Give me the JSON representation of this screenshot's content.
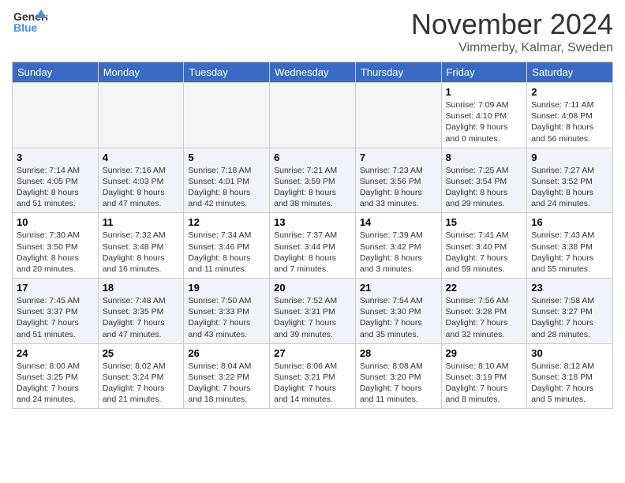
{
  "header": {
    "logo_line1": "General",
    "logo_line2": "Blue",
    "month_title": "November 2024",
    "location": "Vimmerby, Kalmar, Sweden"
  },
  "weekdays": [
    "Sunday",
    "Monday",
    "Tuesday",
    "Wednesday",
    "Thursday",
    "Friday",
    "Saturday"
  ],
  "weeks": [
    [
      {
        "day": "",
        "info": "",
        "empty": true
      },
      {
        "day": "",
        "info": "",
        "empty": true
      },
      {
        "day": "",
        "info": "",
        "empty": true
      },
      {
        "day": "",
        "info": "",
        "empty": true
      },
      {
        "day": "",
        "info": "",
        "empty": true
      },
      {
        "day": "1",
        "info": "Sunrise: 7:09 AM\nSunset: 4:10 PM\nDaylight: 9 hours\nand 0 minutes.",
        "empty": false
      },
      {
        "day": "2",
        "info": "Sunrise: 7:11 AM\nSunset: 4:08 PM\nDaylight: 8 hours\nand 56 minutes.",
        "empty": false
      }
    ],
    [
      {
        "day": "3",
        "info": "Sunrise: 7:14 AM\nSunset: 4:05 PM\nDaylight: 8 hours\nand 51 minutes.",
        "empty": false
      },
      {
        "day": "4",
        "info": "Sunrise: 7:16 AM\nSunset: 4:03 PM\nDaylight: 8 hours\nand 47 minutes.",
        "empty": false
      },
      {
        "day": "5",
        "info": "Sunrise: 7:18 AM\nSunset: 4:01 PM\nDaylight: 8 hours\nand 42 minutes.",
        "empty": false
      },
      {
        "day": "6",
        "info": "Sunrise: 7:21 AM\nSunset: 3:59 PM\nDaylight: 8 hours\nand 38 minutes.",
        "empty": false
      },
      {
        "day": "7",
        "info": "Sunrise: 7:23 AM\nSunset: 3:56 PM\nDaylight: 8 hours\nand 33 minutes.",
        "empty": false
      },
      {
        "day": "8",
        "info": "Sunrise: 7:25 AM\nSunset: 3:54 PM\nDaylight: 8 hours\nand 29 minutes.",
        "empty": false
      },
      {
        "day": "9",
        "info": "Sunrise: 7:27 AM\nSunset: 3:52 PM\nDaylight: 8 hours\nand 24 minutes.",
        "empty": false
      }
    ],
    [
      {
        "day": "10",
        "info": "Sunrise: 7:30 AM\nSunset: 3:50 PM\nDaylight: 8 hours\nand 20 minutes.",
        "empty": false
      },
      {
        "day": "11",
        "info": "Sunrise: 7:32 AM\nSunset: 3:48 PM\nDaylight: 8 hours\nand 16 minutes.",
        "empty": false
      },
      {
        "day": "12",
        "info": "Sunrise: 7:34 AM\nSunset: 3:46 PM\nDaylight: 8 hours\nand 11 minutes.",
        "empty": false
      },
      {
        "day": "13",
        "info": "Sunrise: 7:37 AM\nSunset: 3:44 PM\nDaylight: 8 hours\nand 7 minutes.",
        "empty": false
      },
      {
        "day": "14",
        "info": "Sunrise: 7:39 AM\nSunset: 3:42 PM\nDaylight: 8 hours\nand 3 minutes.",
        "empty": false
      },
      {
        "day": "15",
        "info": "Sunrise: 7:41 AM\nSunset: 3:40 PM\nDaylight: 7 hours\nand 59 minutes.",
        "empty": false
      },
      {
        "day": "16",
        "info": "Sunrise: 7:43 AM\nSunset: 3:38 PM\nDaylight: 7 hours\nand 55 minutes.",
        "empty": false
      }
    ],
    [
      {
        "day": "17",
        "info": "Sunrise: 7:45 AM\nSunset: 3:37 PM\nDaylight: 7 hours\nand 51 minutes.",
        "empty": false
      },
      {
        "day": "18",
        "info": "Sunrise: 7:48 AM\nSunset: 3:35 PM\nDaylight: 7 hours\nand 47 minutes.",
        "empty": false
      },
      {
        "day": "19",
        "info": "Sunrise: 7:50 AM\nSunset: 3:33 PM\nDaylight: 7 hours\nand 43 minutes.",
        "empty": false
      },
      {
        "day": "20",
        "info": "Sunrise: 7:52 AM\nSunset: 3:31 PM\nDaylight: 7 hours\nand 39 minutes.",
        "empty": false
      },
      {
        "day": "21",
        "info": "Sunrise: 7:54 AM\nSunset: 3:30 PM\nDaylight: 7 hours\nand 35 minutes.",
        "empty": false
      },
      {
        "day": "22",
        "info": "Sunrise: 7:56 AM\nSunset: 3:28 PM\nDaylight: 7 hours\nand 32 minutes.",
        "empty": false
      },
      {
        "day": "23",
        "info": "Sunrise: 7:58 AM\nSunset: 3:27 PM\nDaylight: 7 hours\nand 28 minutes.",
        "empty": false
      }
    ],
    [
      {
        "day": "24",
        "info": "Sunrise: 8:00 AM\nSunset: 3:25 PM\nDaylight: 7 hours\nand 24 minutes.",
        "empty": false
      },
      {
        "day": "25",
        "info": "Sunrise: 8:02 AM\nSunset: 3:24 PM\nDaylight: 7 hours\nand 21 minutes.",
        "empty": false
      },
      {
        "day": "26",
        "info": "Sunrise: 8:04 AM\nSunset: 3:22 PM\nDaylight: 7 hours\nand 18 minutes.",
        "empty": false
      },
      {
        "day": "27",
        "info": "Sunrise: 8:06 AM\nSunset: 3:21 PM\nDaylight: 7 hours\nand 14 minutes.",
        "empty": false
      },
      {
        "day": "28",
        "info": "Sunrise: 8:08 AM\nSunset: 3:20 PM\nDaylight: 7 hours\nand 11 minutes.",
        "empty": false
      },
      {
        "day": "29",
        "info": "Sunrise: 8:10 AM\nSunset: 3:19 PM\nDaylight: 7 hours\nand 8 minutes.",
        "empty": false
      },
      {
        "day": "30",
        "info": "Sunrise: 8:12 AM\nSunset: 3:18 PM\nDaylight: 7 hours\nand 5 minutes.",
        "empty": false
      }
    ]
  ]
}
